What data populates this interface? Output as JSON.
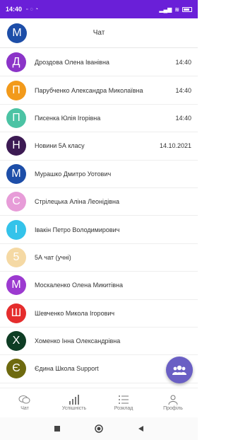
{
  "status_bar": {
    "time": "14:40",
    "icons": [
      "sim-icon",
      "nfc-icon",
      "alarm-icon"
    ]
  },
  "header": {
    "title": "Чат",
    "avatar_letter": "М",
    "avatar_color": "#1d4ea8"
  },
  "chats": [
    {
      "letter": "Д",
      "color": "#8b34c8",
      "name": "Дроздова Олена Іванівна",
      "date": "14:40"
    },
    {
      "letter": "П",
      "color": "#f29a1b",
      "name": "Парубченко Александра Миколаївна",
      "date": "14:40"
    },
    {
      "letter": "П",
      "color": "#4bc3a4",
      "name": "Писенка Юлія Ігорівна",
      "date": "14:40"
    },
    {
      "letter": "Н",
      "color": "#3c1a53",
      "name": "Новини 5А класу",
      "date": "14.10.2021"
    },
    {
      "letter": "М",
      "color": "#1d4ea8",
      "name": "Мурашко Дмитро Уотович",
      "date": ""
    },
    {
      "letter": "С",
      "color": "#e79cd8",
      "name": "Стрілецька Аліна Леонідівна",
      "date": ""
    },
    {
      "letter": "І",
      "color": "#34c3ea",
      "name": "Івакін Петро Володимирович",
      "date": ""
    },
    {
      "letter": "5",
      "color": "#f5d9a4",
      "name": "5А чат (учні)",
      "date": ""
    },
    {
      "letter": "М",
      "color": "#9c3ad0",
      "name": "Москаленко Олена Микитівна",
      "date": ""
    },
    {
      "letter": "Ш",
      "color": "#e52d2d",
      "name": "Шевченко Микола Ігорович",
      "date": ""
    },
    {
      "letter": "Х",
      "color": "#0e3d24",
      "name": "Хоменко Інна Олександрівна",
      "date": ""
    },
    {
      "letter": "Є",
      "color": "#6e6a0f",
      "name": "Єдина Школа Support",
      "date": ""
    }
  ],
  "bottom_nav": [
    {
      "label": "Чат",
      "icon": "chat-icon"
    },
    {
      "label": "Успішність",
      "icon": "bar-chart-icon"
    },
    {
      "label": "Розклад",
      "icon": "list-icon"
    },
    {
      "label": "Профіль",
      "icon": "user-icon"
    }
  ],
  "colors": {
    "status_bar": "#6a1fd8",
    "fab": "#6a5fc4"
  }
}
